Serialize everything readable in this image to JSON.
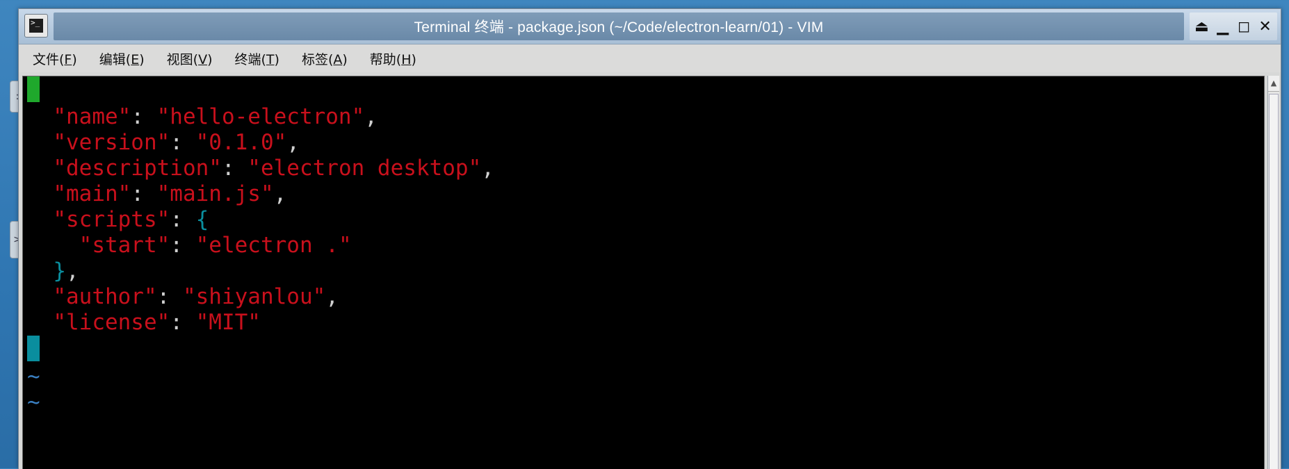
{
  "desktop": {
    "side_tab_1": ":",
    "side_tab_2": ">"
  },
  "window": {
    "title": "Terminal 终端 - package.json (~/Code/electron-learn/01) - VIM",
    "terminal_icon_glyph": ">_",
    "controls": {
      "shade": "⏏",
      "minimize": "▁",
      "maximize": "◻",
      "close": "✕"
    }
  },
  "menu": {
    "items": [
      {
        "label": "文件(",
        "key": "F",
        "suffix": ")"
      },
      {
        "label": "编辑(",
        "key": "E",
        "suffix": ")"
      },
      {
        "label": "视图(",
        "key": "V",
        "suffix": ")"
      },
      {
        "label": "终端(",
        "key": "T",
        "suffix": ")"
      },
      {
        "label": "标签(",
        "key": "A",
        "suffix": ")"
      },
      {
        "label": "帮助(",
        "key": "H",
        "suffix": ")"
      }
    ]
  },
  "editor": {
    "lines": [
      {
        "key": "\"name\"",
        "sep": ": ",
        "value": "\"hello-electron\"",
        "end": ","
      },
      {
        "key": "\"version\"",
        "sep": ": ",
        "value": "\"0.1.0\"",
        "end": ","
      },
      {
        "key": "\"description\"",
        "sep": ": ",
        "value": "\"electron desktop\"",
        "end": ","
      },
      {
        "key": "\"main\"",
        "sep": ": ",
        "value": "\"main.js\"",
        "end": ","
      },
      {
        "key": "\"scripts\"",
        "sep": ": ",
        "brace_open": "{"
      },
      {
        "key": "\"start\"",
        "sep": ": ",
        "value": "\"electron .\""
      },
      {
        "brace_close": "}",
        "end": ","
      },
      {
        "key": "\"author\"",
        "sep": ": ",
        "value": "\"shiyanlou\"",
        "end": ","
      },
      {
        "key": "\"license\"",
        "sep": ": ",
        "value": "\"MIT\""
      }
    ],
    "tilde": "~",
    "colors": {
      "string": "#c9101c",
      "punct": "#d0d0d0",
      "brace": "#0a8e9e",
      "cursor_top": "#1fa82c",
      "cursor_bottom": "#0a8e9e",
      "tilde": "#3a7fc1"
    }
  }
}
